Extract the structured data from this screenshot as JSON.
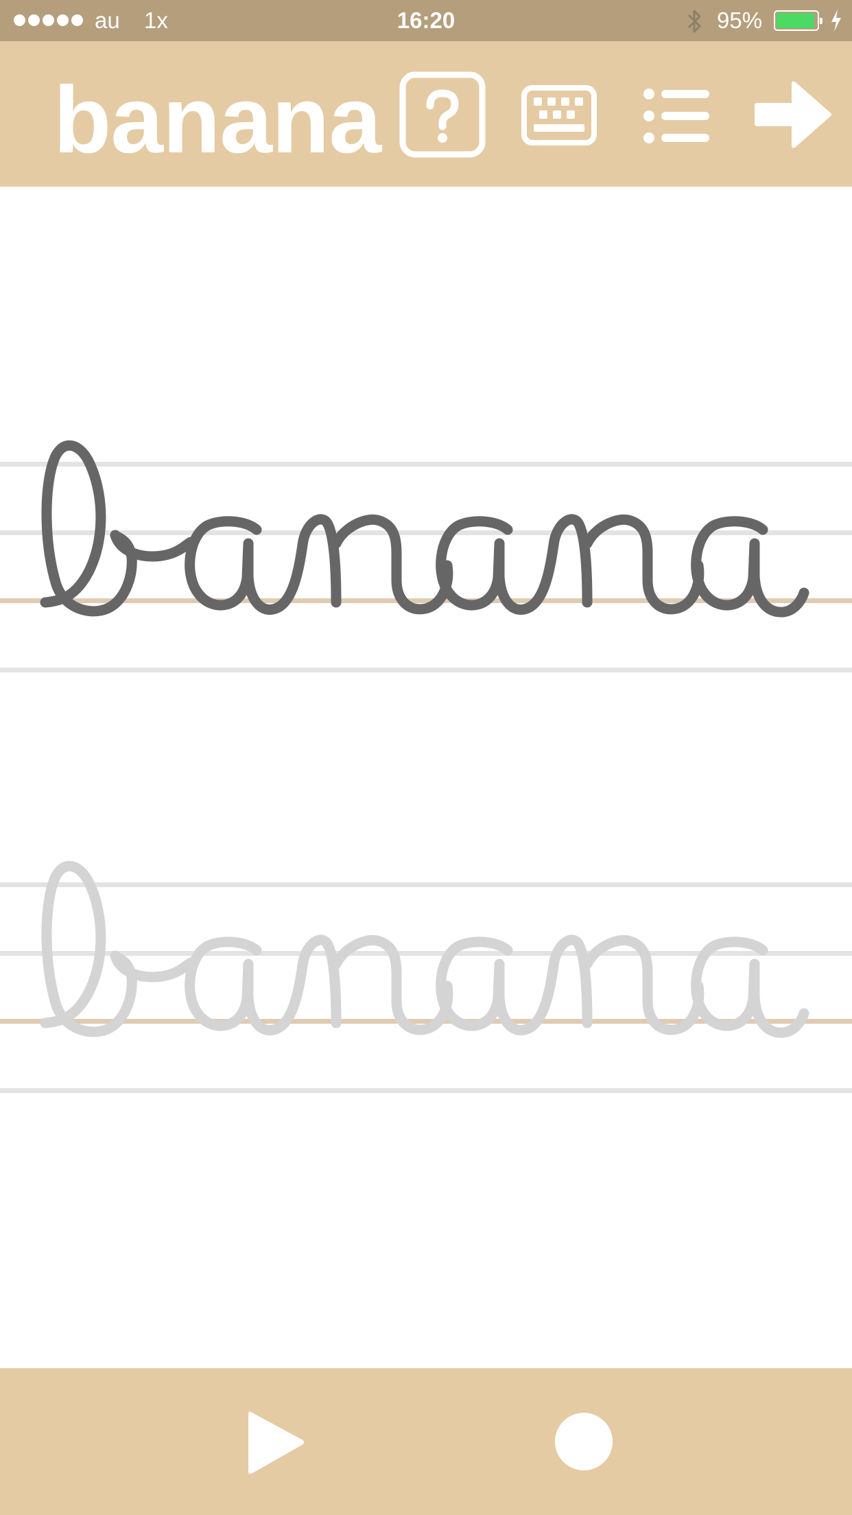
{
  "status_bar": {
    "carrier": "au",
    "network": "1x",
    "time": "16:20",
    "battery_percent": "95%",
    "battery_level": 0.95,
    "icons": [
      "signal-dots-icon",
      "bluetooth-icon",
      "battery-icon",
      "charging-bolt-icon"
    ]
  },
  "toolbar": {
    "word": "banana",
    "icons": [
      "help-question-icon",
      "keyboard-icon",
      "list-icon",
      "next-arrow-icon"
    ]
  },
  "practice": {
    "example_word": "banana",
    "trace_word": "banana"
  },
  "bottom_bar": {
    "icons": [
      "play-icon",
      "record-icon"
    ]
  },
  "colors": {
    "status_bar_bg": "#b59e7c",
    "toolbar_bg": "#e5cba3",
    "guide_line": "#e3e3e3",
    "baseline": "#e0cbb2",
    "example_stroke": "#666666",
    "trace_stroke": "#d4d4d4"
  }
}
